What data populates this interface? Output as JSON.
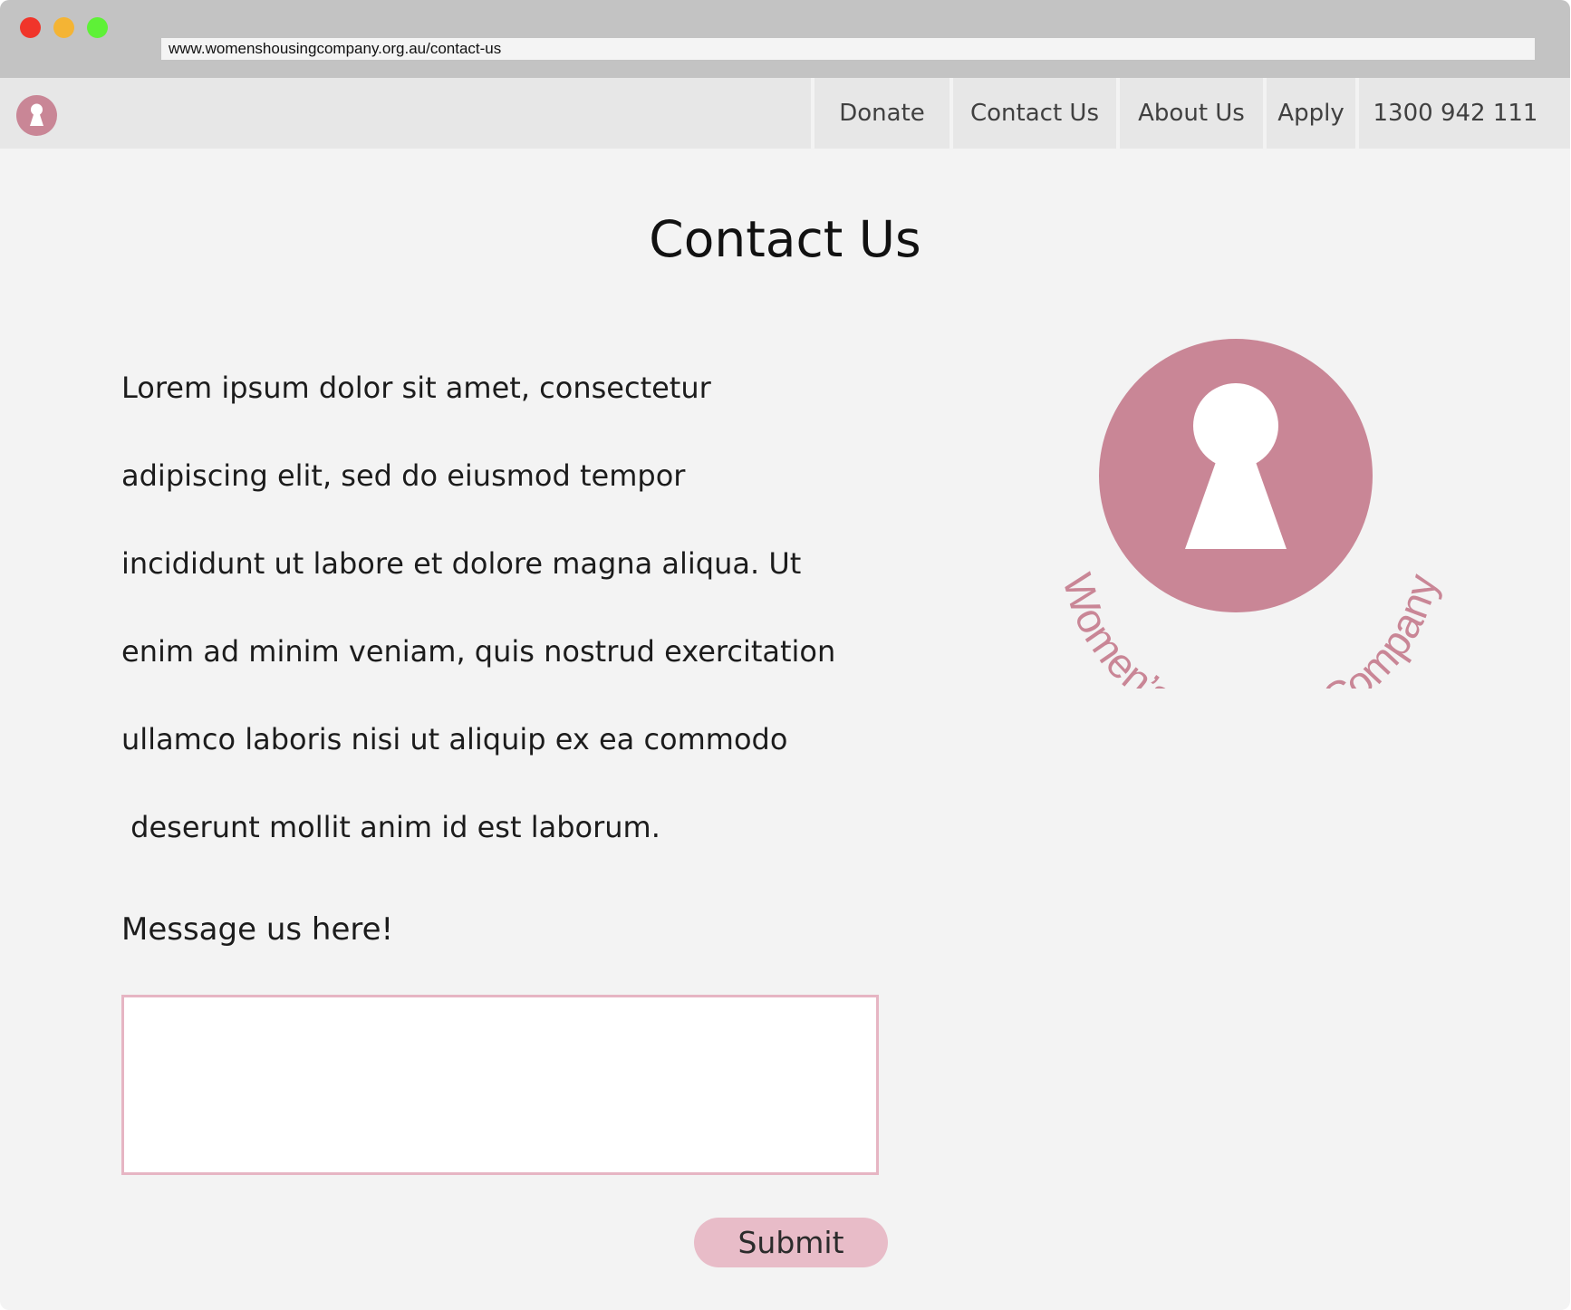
{
  "browser": {
    "url": "www.womenshousingcompany.org.au/contact-us"
  },
  "nav": {
    "items": [
      {
        "label": "Donate"
      },
      {
        "label": "Contact Us"
      },
      {
        "label": "About Us"
      },
      {
        "label": "Apply"
      },
      {
        "label": "1300 942 111"
      }
    ]
  },
  "page": {
    "title": "Contact Us",
    "intro_lines": [
      "Lorem ipsum dolor sit amet, consectetur",
      "adipiscing elit, sed do eiusmod tempor",
      "incididunt ut labore et dolore magna aliqua. Ut",
      "enim ad minim veniam, quis nostrud exercitation",
      "ullamco laboris nisi ut aliquip ex ea commodo",
      " deserunt mollit anim id est laborum."
    ],
    "message_label": "Message us here!",
    "message_value": "",
    "submit_label": "Submit"
  },
  "brand": {
    "name": "Women’s Housing Company",
    "color": "#c98696",
    "accent": "#e8bcc8"
  },
  "icons": {
    "nav_logo": "keyhole-logo-icon",
    "brand_logo": "keyhole-logo-icon"
  }
}
